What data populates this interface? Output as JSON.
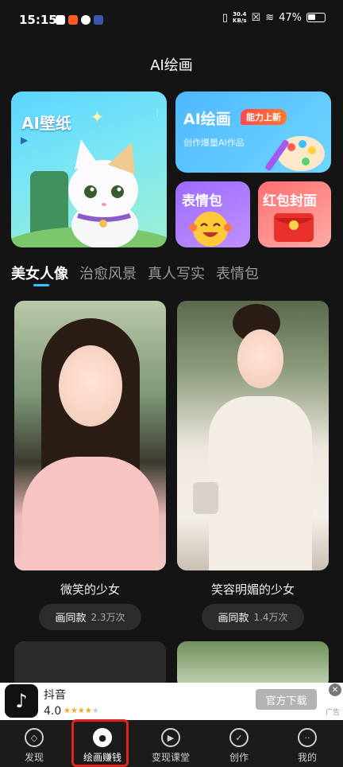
{
  "status_bar": {
    "time": "15:15",
    "net_speed_value": "30.4",
    "net_speed_unit": "KB/s",
    "battery": "47%"
  },
  "page": {
    "title": "AI绘画"
  },
  "features": {
    "wallpaper": {
      "label": "AI壁纸"
    },
    "ai_paint": {
      "label": "AI绘画",
      "badge": "能力上新",
      "subtitle": "创作爆量AI作品"
    },
    "emoji": {
      "label": "表情包"
    },
    "red_packet": {
      "label": "红包封面"
    }
  },
  "tabs": [
    {
      "label": "美女人像",
      "active": true
    },
    {
      "label": "治愈风景",
      "active": false
    },
    {
      "label": "真人写实",
      "active": false
    },
    {
      "label": "表情包",
      "active": false
    }
  ],
  "gallery": [
    {
      "caption": "微笑的少女",
      "button": "画同款",
      "count": "2.3万次"
    },
    {
      "caption": "笑容明媚的少女",
      "button": "画同款",
      "count": "1.4万次"
    }
  ],
  "ad": {
    "app_name": "抖音",
    "rating": "4.0",
    "stars_filled": 4,
    "stars_total": 5,
    "download_label": "官方下载",
    "tag": "广告"
  },
  "bottom_nav": [
    {
      "label": "发现",
      "icon": "compass-icon",
      "active": false
    },
    {
      "label": "绘画赚钱",
      "icon": "palette-icon",
      "active": true
    },
    {
      "label": "变现课堂",
      "icon": "play-icon",
      "active": false
    },
    {
      "label": "创作",
      "icon": "bulb-icon",
      "active": false
    },
    {
      "label": "我的",
      "icon": "face-icon",
      "active": false
    }
  ],
  "colors": {
    "accent": "#34c3ff",
    "highlight": "#e2231a",
    "background": "#141414"
  }
}
